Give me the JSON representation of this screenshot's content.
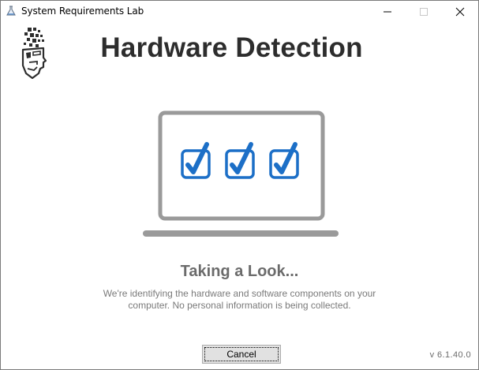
{
  "window": {
    "title": "System Requirements Lab",
    "controls": {
      "minimize_icon": "minimize-icon",
      "maximize_icon": "maximize-icon",
      "close_icon": "close-icon"
    }
  },
  "header": {
    "logo_icon": "robot-head-logo-icon",
    "title": "Hardware Detection"
  },
  "illustration": {
    "icon": "laptop-icon",
    "checkboxes": [
      {
        "icon": "checkbox-checked-icon",
        "checked": true
      },
      {
        "icon": "checkbox-checked-icon",
        "checked": true
      },
      {
        "icon": "checkbox-checked-icon",
        "checked": true
      }
    ]
  },
  "status": {
    "heading": "Taking a Look...",
    "line1": "We're identifying the hardware and software components on your",
    "line2": "computer. No personal information is being collected."
  },
  "footer": {
    "cancel_label": "Cancel",
    "version": "v 6.1.40.0"
  },
  "colors": {
    "accent_blue": "#1c6fc7",
    "laptop_gray": "#9a9a9a",
    "heading_dark": "#2d2d2d",
    "status_gray": "#6b6b6b"
  }
}
